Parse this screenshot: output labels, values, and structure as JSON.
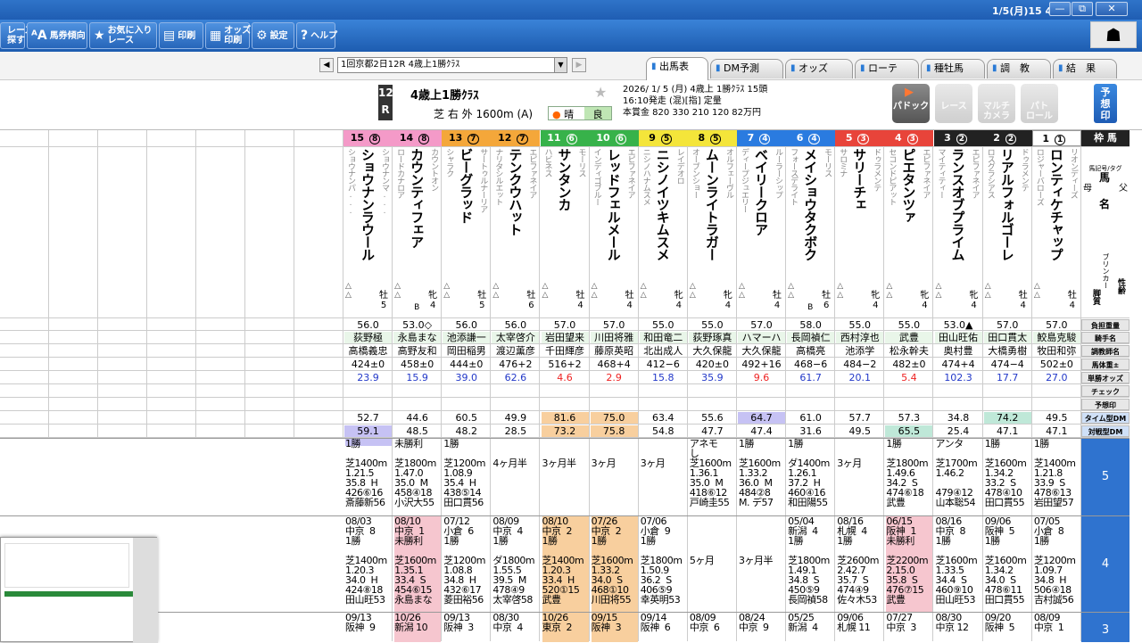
{
  "titlebar": {
    "time": "1/5(月)15 44",
    "min": "—",
    "max": "⧉",
    "close": "✕"
  },
  "toolbar": {
    "buttons": [
      {
        "label": "レースを\n探す",
        "icon": "search-icon",
        "glyph": ""
      },
      {
        "label": "馬券傾向",
        "icon": "aa-icon",
        "glyph": "ᴬA"
      },
      {
        "label": "お気に入り\nレース",
        "icon": "star-icon",
        "glyph": "★"
      },
      {
        "label": "印刷",
        "icon": "printer-icon",
        "glyph": "▤"
      },
      {
        "label": "オッズ\n印刷",
        "icon": "odds-print-icon",
        "glyph": "▦"
      },
      {
        "label": "設定",
        "icon": "gear-icon",
        "glyph": "⚙"
      },
      {
        "label": "ヘルプ",
        "icon": "help-icon",
        "glyph": "?"
      }
    ]
  },
  "race_select": {
    "value": "1回京都2日12R 4歳上1勝ｸﾗｽ"
  },
  "tabs": [
    "出馬表",
    "DM予測",
    "オッズ",
    "ローテ",
    "種牡馬",
    "調　教",
    "結　果"
  ],
  "race": {
    "num": "12",
    "r": "R",
    "name": "4歳上1勝ｸﾗｽ",
    "course": "芝 右 外 1600m (A)",
    "weather": "晴",
    "track": "良",
    "line1": "2026/ 1/ 5 (月)  4歳上  1勝ｸﾗｽ  15頭",
    "line2": "16:10発走  (混)[指]  定量",
    "line3": "本賞金 820 330 210 120 82万円"
  },
  "buttons": {
    "paddock": "パドック",
    "race": "レース",
    "multi": "マルチ\nカメラ",
    "patrol": "パト\nロール",
    "yoso": "予\n想\n印"
  },
  "labels": {
    "waku_ban": "枠 馬",
    "breed": "馬記号/タグ",
    "mother": "母",
    "father": "父",
    "horse_name": "馬\n名",
    "blinker": "ブリンカー",
    "bucho": "脚質",
    "sexage": "性齢",
    "rows": [
      "負担重量",
      "騎手名",
      "調教師名",
      "馬体重±",
      "単勝オッズ",
      "チェック",
      "予想印",
      "タイム型DM",
      "対戦型DM"
    ]
  },
  "horses": [
    {
      "num": "15",
      "waku": "8",
      "name": "ショウナンラウール",
      "sire": "ショウナンマ...",
      "dam": "ショウナンパ...",
      "sex": "牡",
      "age": "5",
      "blinker": "",
      "weight": "56.0",
      "jockey": "荻野極",
      "trainer": "高橋義忠",
      "bw": "424±0",
      "odds": "23.9",
      "tdm": "52.7",
      "vdm": "59.1"
    },
    {
      "num": "14",
      "waku": "8",
      "name": "カウンティフェア",
      "sire": "カウントオン",
      "dam": "ロードカナロア",
      "sex": "牝",
      "age": "4",
      "blinker": "B",
      "weight": "53.0◇",
      "jockey": "永島まな",
      "trainer": "高野友和",
      "bw": "458±0",
      "odds": "15.9",
      "tdm": "44.6",
      "vdm": "48.5"
    },
    {
      "num": "13",
      "waku": "7",
      "name": "ビーグラッド",
      "sire": "サートゥルナーリア",
      "dam": "シャラク",
      "sex": "牡",
      "age": "5",
      "blinker": "",
      "weight": "56.0",
      "jockey": "池添謙一",
      "trainer": "岡田稲男",
      "bw": "444±0",
      "odds": "39.0",
      "tdm": "60.5",
      "vdm": "48.2"
    },
    {
      "num": "12",
      "waku": "7",
      "name": "テンクウハット",
      "sire": "エピファネイア",
      "dam": "ナリタシルエット",
      "sex": "牡",
      "age": "6",
      "blinker": "",
      "weight": "56.0",
      "jockey": "太宰啓介",
      "trainer": "渡辺薫彦",
      "bw": "476+2",
      "odds": "62.6",
      "tdm": "49.9",
      "vdm": "28.5"
    },
    {
      "num": "11",
      "waku": "6",
      "name": "サンタンカ",
      "sire": "モーリス",
      "dam": "ハビネス",
      "sex": "牡",
      "age": "4",
      "blinker": "",
      "weight": "57.0",
      "jockey": "岩田望来",
      "trainer": "千田輝彦",
      "bw": "516+2",
      "odds": "4.6",
      "tdm": "81.6",
      "vdm": "73.2"
    },
    {
      "num": "10",
      "waku": "6",
      "name": "レッドフェルメール",
      "sire": "エピファネイア",
      "dam": "インディゴブルー",
      "sex": "牡",
      "age": "4",
      "blinker": "",
      "weight": "57.0",
      "jockey": "川田将雅",
      "trainer": "藤原英昭",
      "bw": "468+4",
      "odds": "2.9",
      "tdm": "75.0",
      "vdm": "75.8"
    },
    {
      "num": "9",
      "waku": "5",
      "name": "ニシノイツキムスメ",
      "sire": "レイデオロ",
      "dam": "ニシノハナムスメ",
      "sex": "牝",
      "age": "4",
      "blinker": "",
      "weight": "55.0",
      "jockey": "和田竜二",
      "trainer": "北出成人",
      "bw": "412−6",
      "odds": "15.8",
      "tdm": "63.4",
      "vdm": "54.8"
    },
    {
      "num": "8",
      "waku": "5",
      "name": "ムーンライトラガー",
      "sire": "オルフェーヴル",
      "dam": "オーブンショー",
      "sex": "牝",
      "age": "4",
      "blinker": "",
      "weight": "55.0",
      "jockey": "荻野琢真",
      "trainer": "大久保龍",
      "bw": "420±0",
      "odds": "35.9",
      "tdm": "55.6",
      "vdm": "47.7"
    },
    {
      "num": "7",
      "waku": "4",
      "name": "ベイリークロア",
      "sire": "ルーラーシップ",
      "dam": "ディープジュエリー",
      "sex": "牡",
      "age": "4",
      "blinker": "",
      "weight": "57.0",
      "jockey": "ハマーハ",
      "trainer": "大久保龍",
      "bw": "492+16",
      "odds": "9.6",
      "tdm": "64.7",
      "vdm": "47.4"
    },
    {
      "num": "6",
      "waku": "4",
      "name": "メイショウタクボク",
      "sire": "モーリス",
      "dam": "フォースデライト",
      "sex": "牡",
      "age": "6",
      "blinker": "B",
      "weight": "58.0",
      "jockey": "長岡禎仁",
      "trainer": "高橋亮",
      "bw": "468−6",
      "odds": "61.7",
      "tdm": "61.0",
      "vdm": "31.6"
    },
    {
      "num": "5",
      "waku": "3",
      "name": "サリーチェ",
      "sire": "ドゥラメンテ",
      "dam": "サロミナ",
      "sex": "牝",
      "age": "4",
      "blinker": "",
      "weight": "55.0",
      "jockey": "西村淳也",
      "trainer": "池添学",
      "bw": "484−2",
      "odds": "20.1",
      "tdm": "57.7",
      "vdm": "49.5"
    },
    {
      "num": "4",
      "waku": "3",
      "name": "ピエタンツァ",
      "sire": "エピファネイア",
      "dam": "セコンドピアット",
      "sex": "牝",
      "age": "4",
      "blinker": "",
      "weight": "55.0",
      "jockey": "武豊",
      "trainer": "松永幹夫",
      "bw": "482±0",
      "odds": "5.4",
      "tdm": "57.3",
      "vdm": "65.5"
    },
    {
      "num": "3",
      "waku": "2",
      "name": "ランスオブプライム",
      "sire": "エピファネイア",
      "dam": "マイティティー",
      "sex": "牝",
      "age": "4",
      "blinker": "",
      "weight": "53.0▲",
      "jockey": "田山旺佑",
      "trainer": "奥村豊",
      "bw": "474+4",
      "odds": "102.3",
      "tdm": "34.8",
      "vdm": "25.4"
    },
    {
      "num": "2",
      "waku": "2",
      "name": "リアルフォルゴーレ",
      "sire": "ドゥラメンテ",
      "dam": "ロスグラシアス",
      "sex": "牡",
      "age": "4",
      "blinker": "",
      "weight": "57.0",
      "jockey": "田口貫太",
      "trainer": "大橋勇樹",
      "bw": "474−4",
      "odds": "17.7",
      "tdm": "74.2",
      "vdm": "47.1"
    },
    {
      "num": "1",
      "waku": "1",
      "name": "ロンティケチャップ",
      "sire": "リオンディーズ",
      "dam": "ロジャーバローズ",
      "sex": "牡",
      "age": "4",
      "blinker": "",
      "weight": "57.0",
      "jockey": "鮫島克駿",
      "trainer": "牧田和弥",
      "bw": "502±0",
      "odds": "27.0",
      "tdm": "49.5",
      "vdm": "47.1"
    }
  ],
  "past_blocks": {
    "b5": {
      "label": "5",
      "cells": [
        "1勝\n\n芝1400m\n1.21.5\n35.8  H\n426⑥16\n斎藤新56",
        "未勝利\n\n芝1800m\n1.47.0\n35.0  M\n458④18\n小沢大55",
        "1勝\n\n芝1200m\n1.08.9\n35.4  H\n438⑤14\n田口貫56",
        "\n\n4ヶ月半",
        "\n\n3ヶ月半",
        "\n\n3ヶ月",
        "\n\n3ヶ月",
        "アネモ\nし\n芝1600m\n1.36.1\n35.0  M\n418⑥12\n戸崎圭55",
        "1勝\n\n芝1600m\n1.33.2\n36.0  M\n484②8\nM. デ57",
        "1勝\n\nダ1400m\n1.26.1\n37.2  H\n460④16\n和田陽55",
        "\n\n3ヶ月",
        "1勝\n\n芝1800m\n1.49.6\n34.2  S\n474⑥18\n武豊",
        "アンタ\n\n芝1700m\n1.46.2\n\n479④12\n山本聡54",
        "1勝\n\n芝1600m\n1.34.2\n33.2  S\n478④10\n田口貫55",
        "1勝\n\n芝1400m\n1.21.8\n33.9  S\n478⑥13\n岩田望57"
      ]
    },
    "b4": {
      "label": "4",
      "cells": [
        "08/03\n中京  8\n1勝\n\n芝1400m\n1.20.3\n34.0  H\n424⑧18\n田山旺53",
        "08/10\n中京  1\n未勝利\n\n芝1600m\n1.35.1\n33.4  S\n454⑥15\n永島まな",
        "07/12\n小倉  6\n1勝\n\n芝1200m\n1.08.8\n34.8  H\n432⑥17\n菱田裕56",
        "08/09\n中京  4\n1勝\n\nダ1800m\n1.55.5\n39.5  M\n478④9\n太宰啓58",
        "08/10\n中京  2\n1勝\n\n芝1400m\n1.20.3\n33.4  H\n520①15\n武豊",
        "07/26\n中京  2\n1勝\n\n芝1600m\n1.33.2\n34.0  S\n468①10\n川田将55",
        "07/06\n小倉  9\n1勝\n\n芝1800m\n1.50.9\n36.2  S\n406⑤9\n幸英明53",
        "\n\n\n\n5ヶ月",
        "\n\n\n\n3ヶ月半",
        "05/04\n新潟  4\n1勝\n\n芝1800m\n1.49.1\n34.8  S\n450⑤9\n長岡禎58",
        "08/16\n札幌  4\n1勝\n\n芝2600m\n2.42.7\n35.7  S\n474④9\n佐々木53",
        "06/15\n阪神  1\n未勝利\n\n芝2200m\n2.15.0\n35.8  S\n476⑦15\n武豊",
        "08/16\n中京  8\n1勝\n\n芝1600m\n1.33.5\n34.4  S\n460⑨10\n田山旺53",
        "09/06\n阪神  5\n1勝\n\n芝1600m\n1.34.2\n34.0  S\n478⑥11\n田口貫55",
        "07/05\n小倉  8\n1勝\n\n芝1200m\n1.09.7\n34.8  H\n506④18\n吉村誠56"
      ]
    },
    "b3": {
      "label": "3",
      "cells": [
        "09/13\n阪神  9",
        "10/26\n新潟 10",
        "09/13\n阪神  3",
        "08/30\n中京  4",
        "10/26\n東京  2",
        "09/15\n阪神  3",
        "09/14\n阪神  6",
        "08/09\n中京  6",
        "08/24\n中京  9",
        "05/25\n新潟  4",
        "09/06\n札幌 11",
        "07/27\n中京  3",
        "08/30\n中京 12",
        "09/20\n阪神  5",
        "08/09\n中京  1"
      ]
    }
  }
}
